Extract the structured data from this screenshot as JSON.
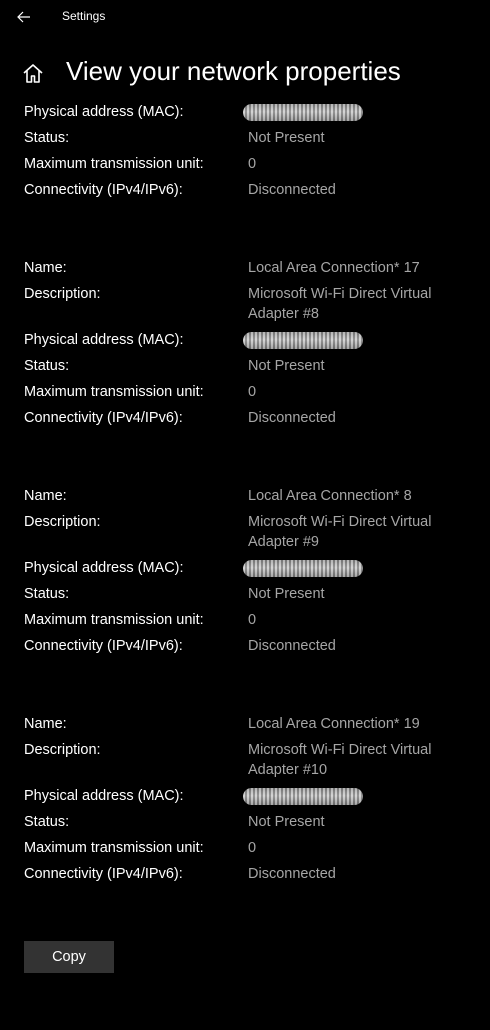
{
  "window": {
    "app_title": "Settings",
    "back_icon": "arrow-left-icon",
    "home_icon": "home-icon"
  },
  "page": {
    "title": "View your network properties"
  },
  "labels": {
    "name": "Name:",
    "description": "Description:",
    "mac": "Physical address (MAC):",
    "status": "Status:",
    "mtu": "Maximum transmission unit:",
    "connectivity": "Connectivity (IPv4/IPv6):"
  },
  "adapters": [
    {
      "status": "Not Present",
      "mtu": "0",
      "connectivity": "Disconnected"
    },
    {
      "name": "Local Area Connection* 17",
      "description_line1": "Microsoft Wi-Fi Direct Virtual",
      "description_line2": "Adapter #8",
      "status": "Not Present",
      "mtu": "0",
      "connectivity": "Disconnected"
    },
    {
      "name": "Local Area Connection* 8",
      "description_line1": "Microsoft Wi-Fi Direct Virtual",
      "description_line2": "Adapter #9",
      "status": "Not Present",
      "mtu": "0",
      "connectivity": "Disconnected"
    },
    {
      "name": "Local Area Connection* 19",
      "description_line1": "Microsoft Wi-Fi Direct Virtual",
      "description_line2": "Adapter #10",
      "status": "Not Present",
      "mtu": "0",
      "connectivity": "Disconnected"
    }
  ],
  "actions": {
    "copy_label": "Copy"
  },
  "colors": {
    "background": "#000000",
    "label": "#ffffff",
    "value": "#a6a6a6",
    "button": "#333333"
  }
}
